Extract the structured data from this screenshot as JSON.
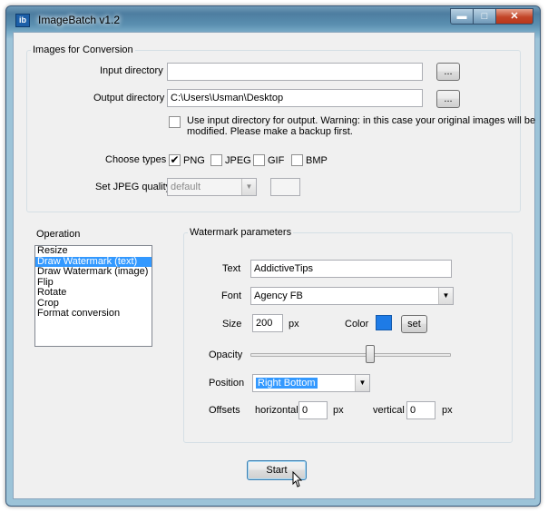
{
  "window": {
    "title": "ImageBatch v1.2",
    "app_icon": "ib",
    "controls": [
      "minimize-icon",
      "maximize-icon",
      "close-icon"
    ]
  },
  "conversion": {
    "legend": "Images for Conversion",
    "input_label": "Input directory",
    "input_value": "",
    "browse_label": "...",
    "output_label": "Output directory",
    "output_value": "C:\\Users\\Usman\\Desktop",
    "use_input_text_1": "Use input directory for output. Warning: in this case your original images will be",
    "use_input_text_2": "modified. Please make a backup first.",
    "use_input_checked": false,
    "types_label": "Choose types",
    "types": [
      {
        "label": "PNG",
        "checked": true
      },
      {
        "label": "JPEG",
        "checked": false
      },
      {
        "label": "GIF",
        "checked": false
      },
      {
        "label": "BMP",
        "checked": false
      }
    ],
    "quality_label": "Set JPEG quality",
    "quality_value": "default",
    "quality_extra": ""
  },
  "operation": {
    "label": "Operation",
    "items": [
      "Resize",
      "Draw Watermark (text)",
      "Draw Watermark (image)",
      "Flip",
      "Rotate",
      "Crop",
      "Format conversion"
    ],
    "selected_index": 1
  },
  "watermark": {
    "legend": "Watermark parameters",
    "text_label": "Text",
    "text_value": "AddictiveTips",
    "font_label": "Font",
    "font_value": "Agency FB",
    "size_label": "Size",
    "size_value": "200",
    "size_unit": "px",
    "color_label": "Color",
    "color_value": "#1e7be6",
    "set_label": "set",
    "opacity_label": "Opacity",
    "opacity_level": 0.6,
    "position_label": "Position",
    "position_value": "Right Bottom",
    "offsets_label": "Offsets",
    "horizontal_label": "horizontal",
    "horizontal_value": "0",
    "vertical_label": "vertical",
    "vertical_value": "0",
    "offset_unit": "px"
  },
  "start_label": "Start"
}
